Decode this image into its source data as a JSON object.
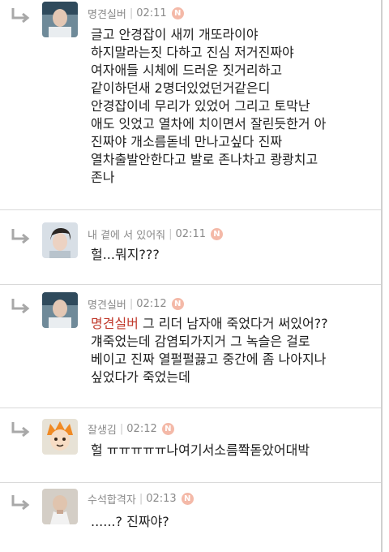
{
  "comments": [
    {
      "author": "명견실버",
      "time": "02:11",
      "badge": "N",
      "avatar": "avatar-person-photo",
      "lines": [
        "글고 안경잡이 새끼 개또라이야",
        "하지말라는짓 다하고 진심 저거진짜야",
        "여자애들 시체에 드러운 짓거리하고",
        "같이하던새 2명더있었던거같은디",
        "안경잡이네 무리가 있었어 그리고 토막난",
        "애도 잇었고 열차에 치이면서 잘린듯한거 아",
        "진짜야 개소름돋네 만나고싶다 진짜",
        "열차출발안한다고 발로 존나차고 쾅쾅치고",
        "존나"
      ]
    },
    {
      "author": "내 곁에 서 있어줘",
      "time": "02:11",
      "badge": "N",
      "avatar": "avatar-person-photo",
      "lines": [
        "헐...뭐지???"
      ]
    },
    {
      "author": "명견실버",
      "time": "02:12",
      "badge": "N",
      "avatar": "avatar-person-photo",
      "mention": "명견실버",
      "first_line_rest": " 그 리더 남자애 죽었다거 써있어??",
      "lines": [
        "걔죽었는데 감염되가지거 그 녹슬은 걸로",
        "베이고 진짜 열펄펄끓고 중간에 좀 나아지나",
        "싶었다가 죽었는데"
      ]
    },
    {
      "author": "잘생김",
      "time": "02:12",
      "badge": "N",
      "avatar": "avatar-cartoon",
      "lines": [
        "헐 ㅠㅠㅠㅠㅠ나여기서소름쫙돋았어대박"
      ]
    },
    {
      "author": "수석합격자",
      "time": "02:13",
      "badge": "N",
      "avatar": "avatar-person-photo",
      "lines": [
        "......? 진짜야?"
      ]
    }
  ],
  "colors": {
    "meta_text": "#8a8a8a",
    "badge_bg": "#f4b9a8",
    "mention": "#c0392b",
    "divider": "#d9d9d9"
  }
}
